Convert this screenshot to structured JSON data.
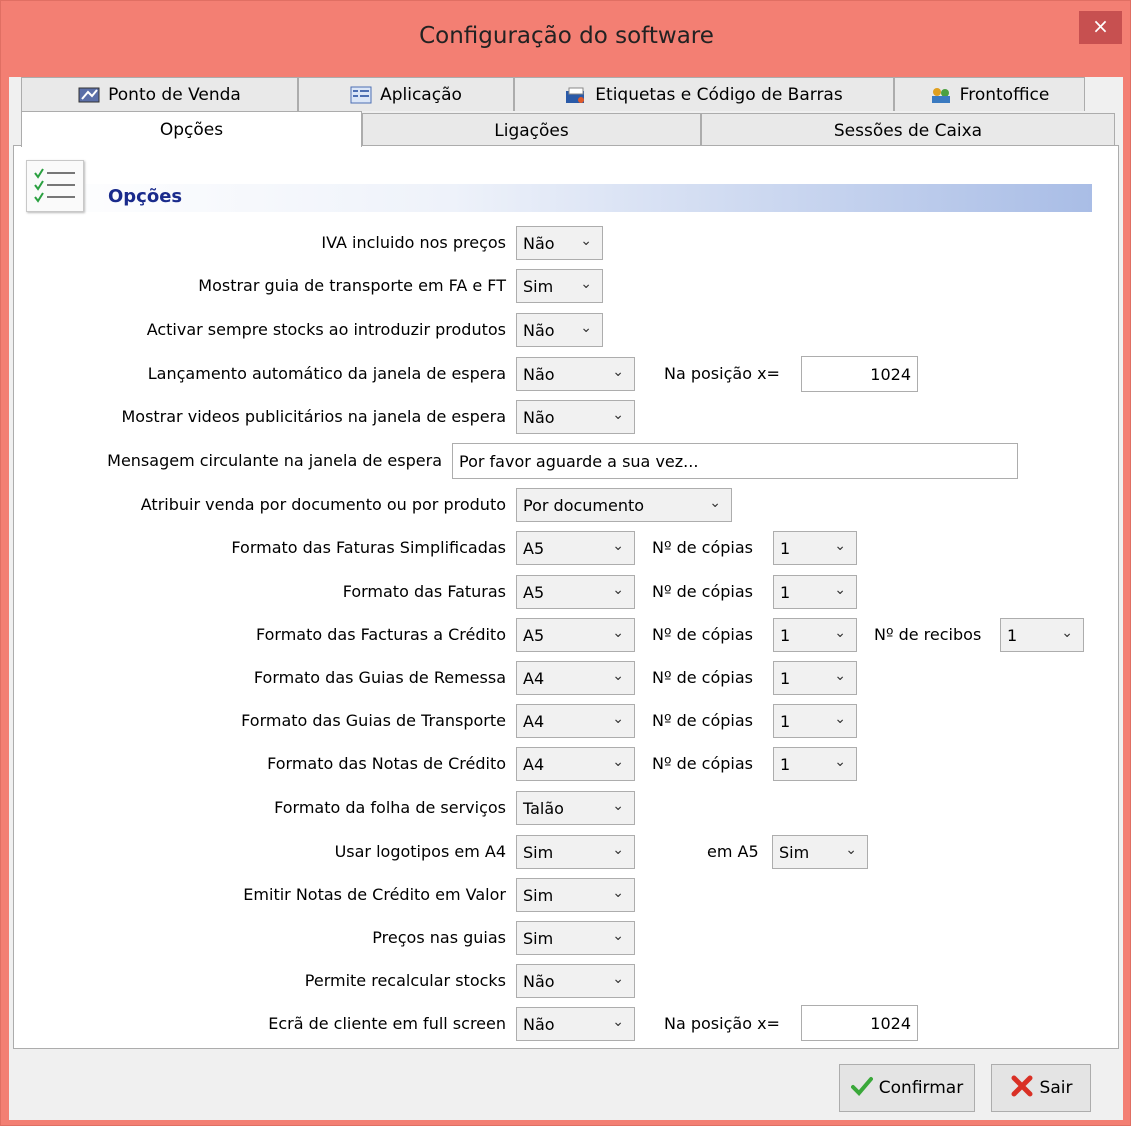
{
  "window": {
    "title": "Configuração do software",
    "close": "×"
  },
  "tabs_row1": [
    {
      "label": "Ponto de Venda",
      "icon": "pos-icon"
    },
    {
      "label": "Aplicação",
      "icon": "app-icon"
    },
    {
      "label": "Etiquetas e Código de Barras",
      "icon": "barcode-icon"
    },
    {
      "label": "Frontoffice",
      "icon": "frontoffice-icon"
    }
  ],
  "tabs_row2": [
    {
      "label": "Opções",
      "active": true
    },
    {
      "label": "Ligações"
    },
    {
      "label": "Sessões de Caixa"
    }
  ],
  "section": {
    "title": "Opções",
    "icon": "checklist-icon"
  },
  "rows": {
    "iva": {
      "label": "IVA incluido nos preços",
      "value": "Não"
    },
    "guia": {
      "label": "Mostrar guia de transporte em FA e FT",
      "value": "Sim"
    },
    "stocks": {
      "label": "Activar sempre stocks ao introduzir produtos",
      "value": "Não"
    },
    "lancamento": {
      "label": "Lançamento automático da janela de espera",
      "value": "Não",
      "pos_label": "Na posição x=",
      "pos_value": "1024"
    },
    "videos": {
      "label": "Mostrar videos publicitários na janela de espera",
      "value": "Não"
    },
    "mensagem": {
      "label": "Mensagem circulante na janela de espera",
      "value": "Por favor aguarde a sua vez..."
    },
    "atribuir": {
      "label": "Atribuir venda por documento ou por produto",
      "value": "Por documento"
    },
    "fs": {
      "label": "Formato das Faturas Simplificadas",
      "value": "A5",
      "copies_label": "Nº de cópias",
      "copies": "1"
    },
    "ft": {
      "label": "Formato das Faturas",
      "value": "A5",
      "copies_label": "Nº de cópias",
      "copies": "1"
    },
    "fc": {
      "label": "Formato das Facturas a Crédito",
      "value": "A5",
      "copies_label": "Nº de cópias",
      "copies": "1",
      "recibos_label": "Nº de recibos",
      "recibos": "1"
    },
    "gr": {
      "label": "Formato das Guias de Remessa",
      "value": "A4",
      "copies_label": "Nº de cópias",
      "copies": "1"
    },
    "gt": {
      "label": "Formato das Guias de Transporte",
      "value": "A4",
      "copies_label": "Nº de cópias",
      "copies": "1"
    },
    "nc": {
      "label": "Formato das Notas de Crédito",
      "value": "A4",
      "copies_label": "Nº de cópias",
      "copies": "1"
    },
    "fs2": {
      "label": "Formato da folha de serviços",
      "value": "Talão"
    },
    "logo": {
      "label": "Usar logotipos em A4",
      "value": "Sim",
      "a5_label": "em A5",
      "a5_value": "Sim"
    },
    "emitir": {
      "label": "Emitir Notas de Crédito em Valor",
      "value": "Sim"
    },
    "precos": {
      "label": "Preços nas guias",
      "value": "Sim"
    },
    "recalc": {
      "label": "Permite recalcular stocks",
      "value": "Não"
    },
    "ecra": {
      "label": "Ecrã de cliente em full screen",
      "value": "Não",
      "pos_label": "Na posição x=",
      "pos_value": "1024"
    }
  },
  "buttons": {
    "confirm": "Confirmar",
    "exit": "Sair"
  },
  "colors": {
    "titlebar": "#f37f73",
    "close": "#c75050",
    "highlight": "#22a83a",
    "section_title": "#1a2b8c"
  }
}
